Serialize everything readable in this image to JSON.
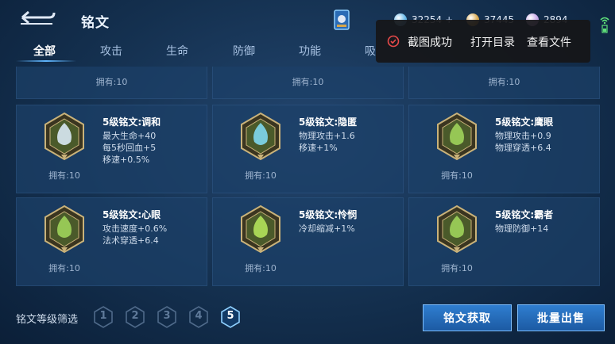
{
  "header": {
    "title": "铭文"
  },
  "currency": [
    {
      "value": "32254",
      "color": "#63b6e8",
      "has_plus": true
    },
    {
      "value": "37445",
      "color": "#d7a64a",
      "has_plus": false
    },
    {
      "value": "2894",
      "color": "#c6a6e8",
      "has_plus": false
    }
  ],
  "plus": "+",
  "tabs": [
    "全部",
    "攻击",
    "生命",
    "防御",
    "功能",
    "吸"
  ],
  "active_tab": 0,
  "top_row_owned": [
    "拥有:10",
    "拥有:10",
    "拥有:10"
  ],
  "cards": [
    {
      "name": "5级铭文:调和",
      "stats": [
        "最大生命+40",
        "每5秒回血+5",
        "移速+0.5%"
      ],
      "owned": "拥有:10",
      "emblem": "crystal-white-icon",
      "accent": "#d9e9f4",
      "frame": "#c9b27a"
    },
    {
      "name": "5级铭文:隐匿",
      "stats": [
        "物理攻击+1.6",
        "移速+1%"
      ],
      "owned": "拥有:10",
      "emblem": "flame-blue-icon",
      "accent": "#7fd8ee",
      "frame": "#c9b27a"
    },
    {
      "name": "5级铭文:鹰眼",
      "stats": [
        "物理攻击+0.9",
        "物理穿透+6.4"
      ],
      "owned": "拥有:10",
      "emblem": "eagle-green-icon",
      "accent": "#9ed35a",
      "frame": "#c9b27a"
    },
    {
      "name": "5级铭文:心眼",
      "stats": [
        "攻击速度+0.6%",
        "法术穿透+6.4"
      ],
      "owned": "拥有:10",
      "emblem": "book-green-icon",
      "accent": "#9ed35a",
      "frame": "#c9b27a"
    },
    {
      "name": "5级铭文:怜悯",
      "stats": [
        "冷却缩减+1%"
      ],
      "owned": "拥有:10",
      "emblem": "star-green-icon",
      "accent": "#b3e25a",
      "frame": "#c9b27a"
    },
    {
      "name": "5级铭文:霸者",
      "stats": [
        "物理防御+14"
      ],
      "owned": "拥有:10",
      "emblem": "shield-green-icon",
      "accent": "#9ed35a",
      "frame": "#c9b27a"
    }
  ],
  "filter": {
    "label": "铭文等级筛选",
    "levels": [
      "1",
      "2",
      "3",
      "4",
      "5"
    ],
    "selected": "5"
  },
  "buttons": {
    "obtain": "铭文获取",
    "batch_sell": "批量出售"
  },
  "toast": {
    "message": "截图成功",
    "open_dir": "打开目录",
    "view_file": "查看文件"
  }
}
